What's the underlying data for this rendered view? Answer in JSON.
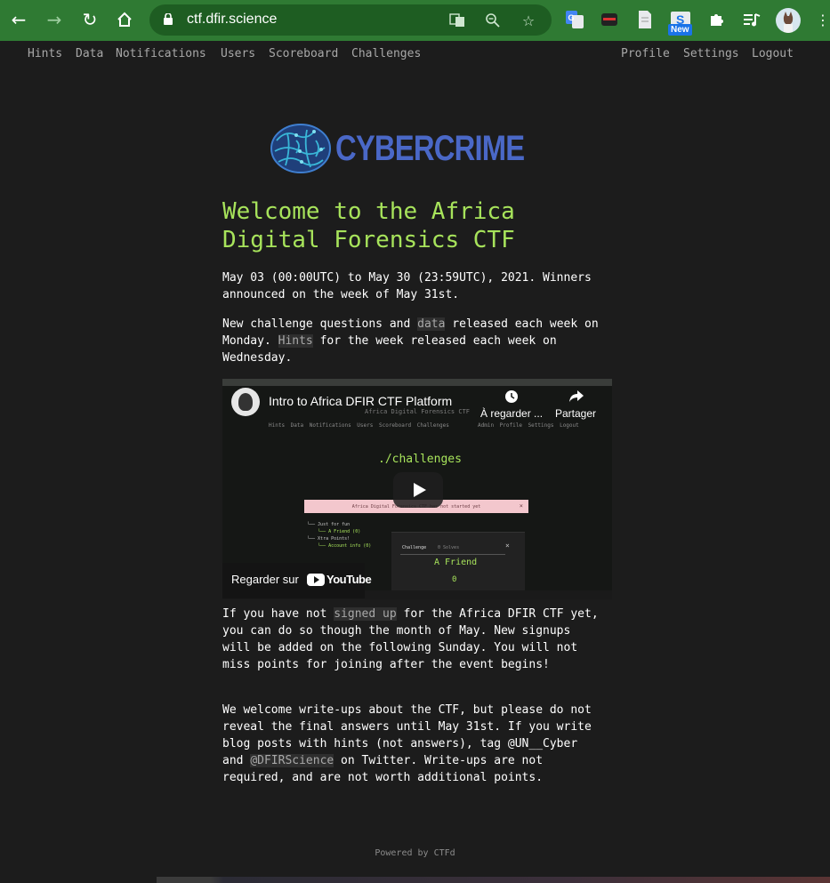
{
  "browser": {
    "url": "ctf.dfir.science",
    "new_badge": "New"
  },
  "nav": {
    "left": [
      "Hints",
      "Data",
      "Notifications",
      "Users",
      "Scoreboard",
      "Challenges"
    ],
    "right": [
      "Profile",
      "Settings",
      "Logout"
    ]
  },
  "logo": {
    "text": "CYBERCRIME",
    "color": "#4a68c7"
  },
  "main": {
    "title": "Welcome to the Africa Digital Forensics CTF",
    "dates": "May 03 (00:00UTC) to May 30 (23:59UTC), 2021. Winners announced on the week of May 31st.",
    "p2_a": "New challenge questions and ",
    "p2_link1": "data",
    "p2_b": " released each week on Monday. ",
    "p2_link2": "Hints",
    "p2_c": " for the week released each week on Wednesday.",
    "p3_a": "If you have not ",
    "p3_link": "signed up",
    "p3_b": " for the Africa DFIR CTF yet, you can do so though the month of May. New signups will be added on the following Sunday. You will not miss points for joining after the event begins!",
    "p4_a": "We welcome write-ups about the CTF, but please do not reveal the final answers until May 31st. If you write blog posts with hints (not answers), tag @UN__Cyber and ",
    "p4_link": "@DFIRScience",
    "p4_b": " on Twitter. Write-ups are not required, and are not worth additional points."
  },
  "video": {
    "title": "Intro to Africa DFIR CTF Platform",
    "subtitle": "Africa Digital Forensics CTF",
    "menu": "Hints Data Notifications Users Scoreboard Challenges",
    "menu_right": "Admin Profile Settings Logout",
    "watch_later": "À regarder ...",
    "share": "Partager",
    "challenges_heading": "./challenges",
    "alert": "Africa Digital Forensics CTF has not started yet",
    "tree_1": "Just for fun",
    "tree_2": "A Friend (0)",
    "tree_3": "Xtra Points!",
    "tree_4": "Account info (0)",
    "modal_tab": "Challenge",
    "modal_solves": "0 Solves",
    "modal_name": "A Friend",
    "modal_points": "0",
    "watch_on": "Regarder sur",
    "youtube": "YouTube"
  },
  "footer": "Powered by CTFd",
  "colors": {
    "accent": "#a7e35b",
    "chrome": "#2f7a33",
    "background": "#1c1c1c"
  }
}
